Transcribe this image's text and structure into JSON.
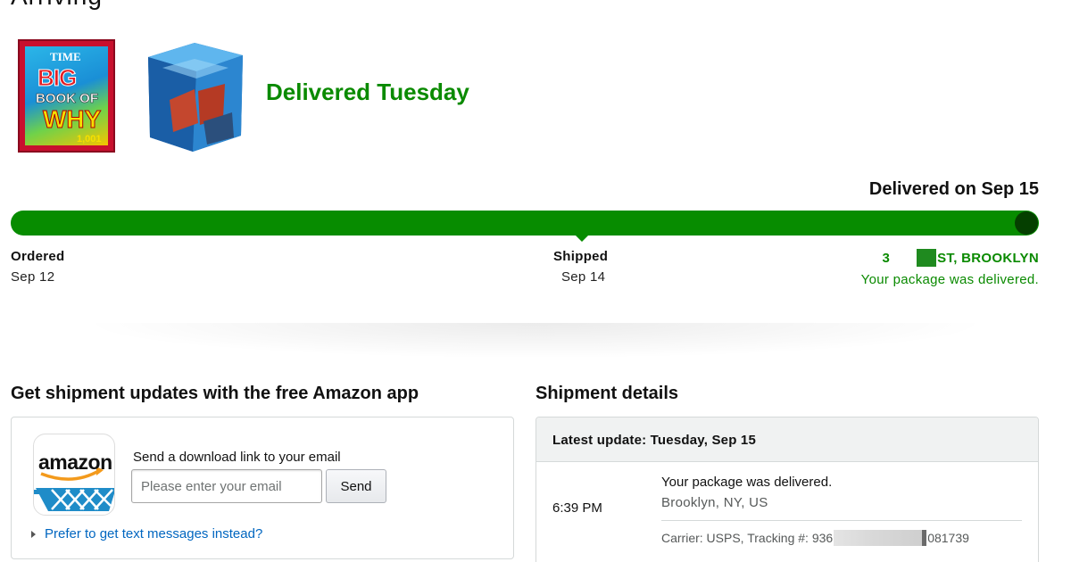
{
  "header": {
    "cut_title": "Arriving"
  },
  "status": {
    "headline": "Delivered Tuesday",
    "delivered_on": "Delivered on Sep 15",
    "progress_fraction": 1.0,
    "accent_color": "#078c00"
  },
  "products": [
    {
      "name": "Big Book of Why book cover",
      "cover_time": "TIME",
      "cover_line1": "BIG",
      "cover_line2": "BOOK OF",
      "cover_line3": "WHY",
      "cover_num": "1,001"
    },
    {
      "name": "Adams Cube puzzle box"
    }
  ],
  "steps": [
    {
      "label": "Ordered",
      "date": "Sep 12"
    },
    {
      "label": "Shipped",
      "date": "Sep 14"
    },
    {
      "label_start": "3",
      "label_end": "ST, BROOKLYN",
      "date": "Your package was delivered."
    }
  ],
  "app_section": {
    "title": "Get shipment updates with the free Amazon app",
    "icon_word": "amazon",
    "send_label": "Send a download link to your email",
    "email_placeholder": "Please enter your email",
    "email_value": "",
    "send_button": "Send",
    "text_link": "Prefer to get text messages instead?"
  },
  "shipment": {
    "title": "Shipment details",
    "latest_update": "Latest update: Tuesday, Sep 15",
    "time": "6:39 PM",
    "message": "Your package was delivered.",
    "location": "Brooklyn, NY, US",
    "carrier_prefix": "Carrier: USPS, Tracking #: 936",
    "carrier_suffix": "081739"
  }
}
